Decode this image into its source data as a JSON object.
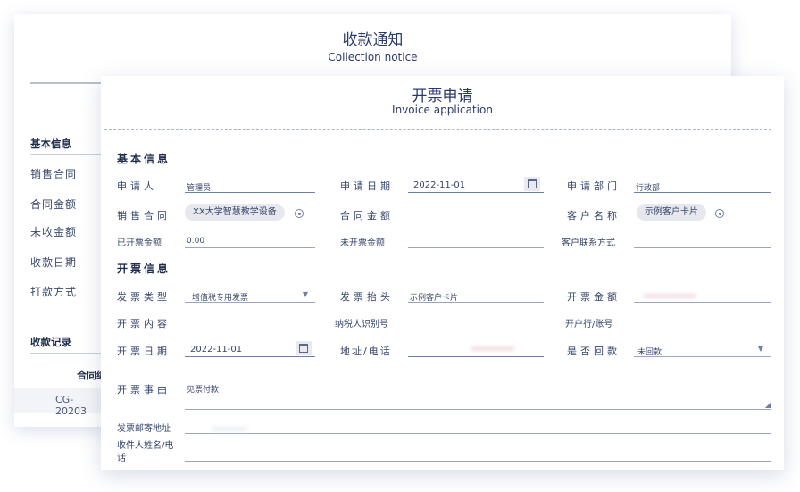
{
  "collection_notice": {
    "title_cn": "收款通知",
    "title_en": "Collection notice",
    "basic_info": "基本信息",
    "labels": [
      "销售合同",
      "合同金额",
      "未收金额",
      "收款日期",
      "打款方式"
    ],
    "records_title": "收款记录",
    "records_col_partial": "合同编",
    "records_cell_partial": "CG-20203"
  },
  "invoice": {
    "title_cn": "开票申请",
    "title_en": "Invoice application",
    "basic_info_title": "基本信息",
    "invoice_info_title": "开票信息",
    "applicant_label": "申请人",
    "applicant_value": "管理员",
    "apply_date_label": "申请日期",
    "apply_date_value": "2022-11-01",
    "dept_label": "申请部门",
    "dept_value": "行政部",
    "contract_label": "销售合同",
    "contract_value": "XX大学智慧教学设备",
    "contract_amount_label": "合同金额",
    "customer_label": "客户名称",
    "customer_value": "示例客户卡片",
    "invoiced_label": "已开票金额",
    "invoiced_value": "0.00",
    "uninvoiced_label": "未开票金额",
    "contact_label": "客户联系方式",
    "invoice_type_label": "发票类型",
    "invoice_type_value": "增值税专用发票",
    "invoice_header_label": "发票抬头",
    "invoice_header_value": "示例客户卡片",
    "invoice_amount_label": "开票金额",
    "content_label": "开票内容",
    "taxid_label": "纳税人识别号",
    "bank_label": "开户行/账号",
    "invoice_date_label": "开票日期",
    "invoice_date_value": "2022-11-01",
    "address_label": "地址/电话",
    "returned_label": "是否回款",
    "returned_value": "未回款",
    "reason_label": "开票事由",
    "reason_value": "见票付款",
    "mail_addr_label": "发票邮寄地址",
    "recipient_label": "收件人姓名/电话"
  },
  "colors": {
    "title": "#2c3a6b",
    "label": "#36466a",
    "chip_bg": "#e6e8ee"
  },
  "icons": [
    "calendar-icon",
    "add-circle-icon",
    "chevron-down-icon",
    "resize-handle-icon"
  ]
}
